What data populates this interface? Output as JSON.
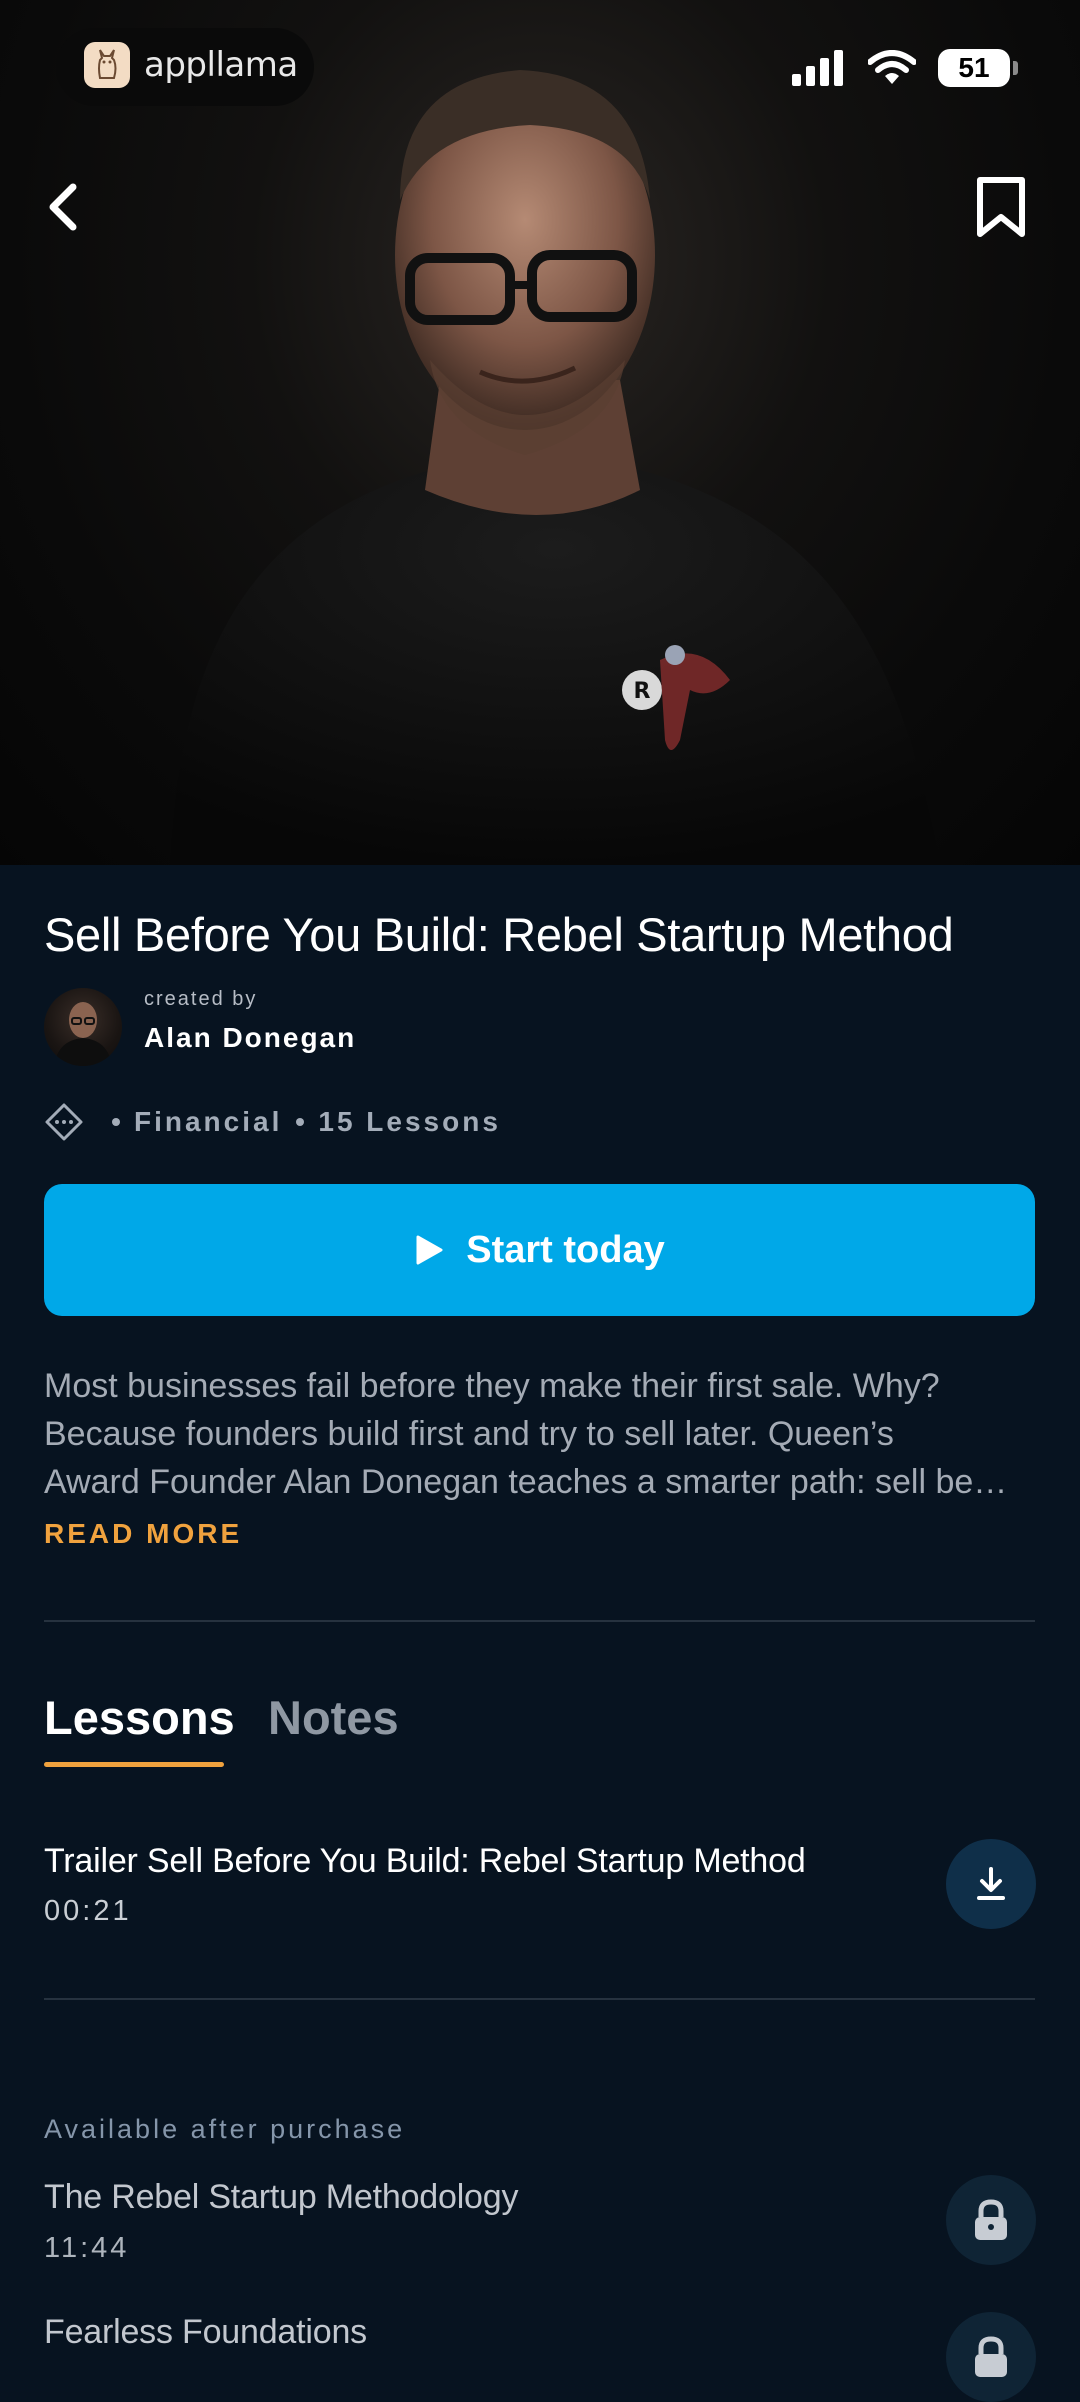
{
  "status_bar": {
    "app_name": "appllama",
    "battery": "51"
  },
  "course": {
    "title": "Sell Before You Build: Rebel Startup Method",
    "created_by_label": "created by",
    "creator_name": "Alan Donegan",
    "category": "Financial",
    "lessons_count": "15 Lessons",
    "start_label": "Start today",
    "description_lines": [
      "Most businesses fail before they make their first sale. Why?",
      "Because founders build first and try to sell later. Queen’s",
      "Award Founder Alan Donegan teaches a smarter path: sell be…"
    ],
    "read_more": "READ MORE"
  },
  "tabs": [
    {
      "label": "Lessons",
      "active": true
    },
    {
      "label": "Notes",
      "active": false
    }
  ],
  "lessons": [
    {
      "title": "Trailer Sell Before You Build: Rebel Startup Method",
      "duration": "00:21",
      "action": "download-icon"
    }
  ],
  "locked_section": {
    "label": "Available after purchase",
    "lessons": [
      {
        "title": "The Rebel Startup Methodology",
        "duration": "11:44",
        "action": "lock-icon"
      },
      {
        "title": "Fearless Foundations",
        "duration": "",
        "action": "lock-icon"
      }
    ]
  },
  "colors": {
    "background": "#071320",
    "accent": "#00a8e8",
    "tab_underline": "#f0a23e",
    "read_more": "#f0a23e"
  }
}
